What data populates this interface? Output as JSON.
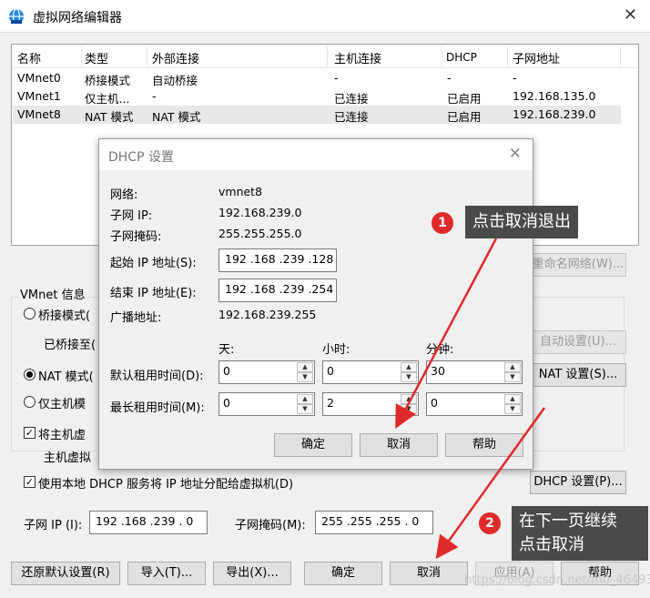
{
  "window": {
    "title": "虚拟网络编辑器",
    "close": "✕"
  },
  "table": {
    "headers": [
      "名称",
      "类型",
      "外部连接",
      "主机连接",
      "DHCP",
      "子网地址"
    ],
    "rows": [
      [
        "VMnet0",
        "桥接模式",
        "自动桥接",
        "-",
        "-",
        "-"
      ],
      [
        "VMnet1",
        "仅主机...",
        "-",
        "已连接",
        "已启用",
        "192.168.135.0"
      ],
      [
        "VMnet8",
        "NAT 模式",
        "NAT 模式",
        "已连接",
        "已启用",
        "192.168.239.0"
      ]
    ]
  },
  "main": {
    "rename_btn": "重命名网络(W)...",
    "vmnet_info": "VMnet 信息",
    "bridge_mode": "桥接模式(",
    "bridged_to": "已桥接至(",
    "auto_settings_btn": "自动设置(U)...",
    "nat_mode": "NAT 模式(",
    "nat_settings_btn": "NAT 设置(S)...",
    "host_only": "仅主机模",
    "connect_host": "将主机虚",
    "host_adapter": "主机虚拟",
    "use_dhcp": "使用本地 DHCP 服务将 IP 地址分配给虚拟机(D)",
    "dhcp_settings_btn": "DHCP 设置(P)...",
    "subnet_ip_label": "子网 IP (I):",
    "subnet_ip_value": "192 .168 .239 .  0",
    "subnet_mask_label": "子网掩码(M):",
    "subnet_mask_value": "255 .255 .255 .  0"
  },
  "footer": {
    "restore": "还原默认设置(R)",
    "import": "导入(T)...",
    "export": "导出(X)...",
    "ok": "确定",
    "cancel": "取消",
    "apply": "应用(A)",
    "help": "帮助"
  },
  "dhcp": {
    "title": "DHCP 设置",
    "close": "✕",
    "network_label": "网络:",
    "network_value": "vmnet8",
    "subnet_ip_label": "子网 IP:",
    "subnet_ip_value": "192.168.239.0",
    "subnet_mask_label": "子网掩码:",
    "subnet_mask_value": "255.255.255.0",
    "start_ip_label": "起始 IP 地址(S):",
    "start_ip_value": "192 .168 .239 .128",
    "end_ip_label": "结束 IP 地址(E):",
    "end_ip_value": "192 .168 .239 .254",
    "broadcast_label": "广播地址:",
    "broadcast_value": "192.168.239.255",
    "days_label": "天:",
    "hours_label": "小时:",
    "minutes_label": "分钟:",
    "default_lease_label": "默认租用时间(D):",
    "default_days": "0",
    "default_hours": "0",
    "default_minutes": "30",
    "max_lease_label": "最长租用时间(M):",
    "max_days": "0",
    "max_hours": "2",
    "max_minutes": "0",
    "ok": "确定",
    "cancel": "取消",
    "help": "帮助"
  },
  "annotations": {
    "n1": "1",
    "callout1": "点击取消退出",
    "n2": "2",
    "callout2_line1": "在下一页继续",
    "callout2_line2": "点击取消",
    "arrow_color": "#e02a2a"
  },
  "watermark": "https://blog.csdn.net/m0_46493581"
}
